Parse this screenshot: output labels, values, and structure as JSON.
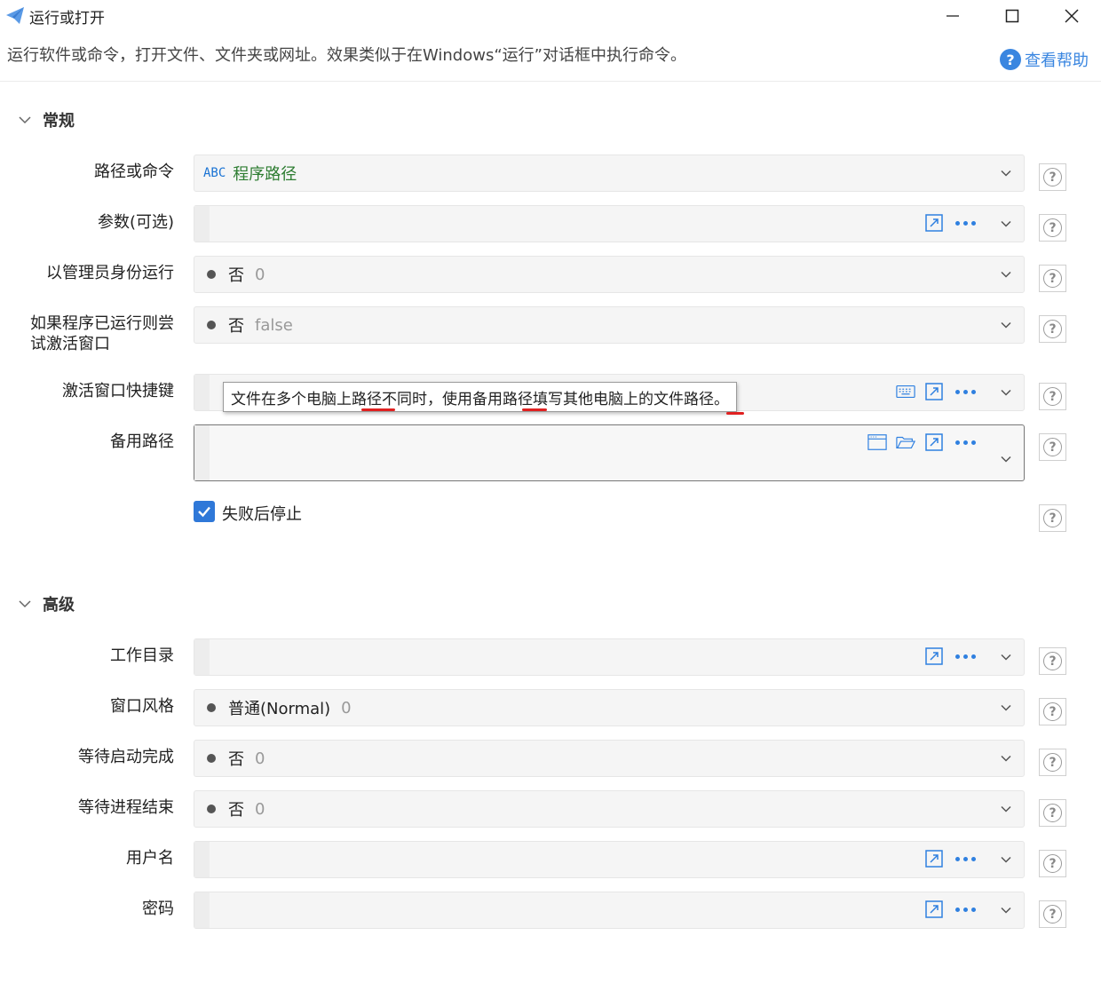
{
  "window": {
    "title": "运行或打开",
    "description": "运行软件或命令，打开文件、文件夹或网址。效果类似于在Windows“运行”对话框中执行命令。",
    "help_label": "查看帮助",
    "help_icon_glyph": "?"
  },
  "sections": {
    "general": "常规",
    "advanced": "高级"
  },
  "general_fields": {
    "path": {
      "label": "路径或命令",
      "type_tag": "ABC",
      "value": "程序路径"
    },
    "args": {
      "label": "参数(可选)",
      "value": ""
    },
    "run_as_admin": {
      "label": "以管理员身份运行",
      "value": "否",
      "raw": "0"
    },
    "activate_if_running": {
      "label": "如果程序已运行则尝试激活窗口",
      "label_line1": "如果程序已运行则尝",
      "label_line2": "试激活窗口",
      "value": "否",
      "raw": "false"
    },
    "activate_hotkey": {
      "label": "激活窗口快捷键",
      "value": ""
    },
    "backup_path": {
      "label": "备用路径",
      "value": ""
    },
    "stop_on_fail": {
      "label": "失败后停止",
      "checked": true
    }
  },
  "tooltip": {
    "text": "文件在多个电脑上路径不同时，使用备用路径填写其他电脑上的文件路径。"
  },
  "advanced_fields": {
    "work_dir": {
      "label": "工作目录",
      "value": ""
    },
    "window_style": {
      "label": "窗口风格",
      "value": "普通(Normal)",
      "raw": "0"
    },
    "wait_start": {
      "label": "等待启动完成",
      "value": "否",
      "raw": "0"
    },
    "wait_exit": {
      "label": "等待进程结束",
      "value": "否",
      "raw": "0"
    },
    "username": {
      "label": "用户名",
      "value": ""
    },
    "password": {
      "label": "密码",
      "value": ""
    }
  },
  "help_button_glyph": "?",
  "colors": {
    "accent": "#2f80e0",
    "marker": "#e02020",
    "path_value": "#2e7d32"
  }
}
